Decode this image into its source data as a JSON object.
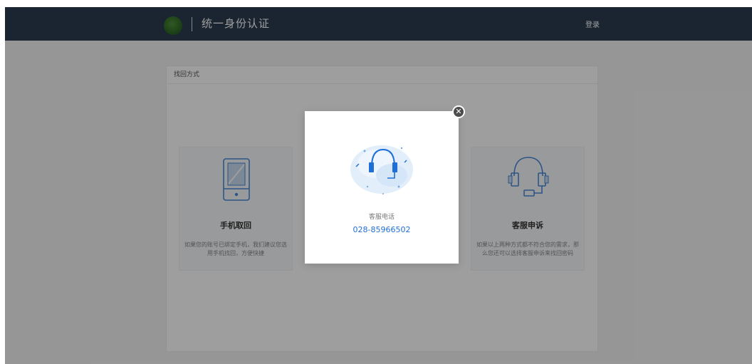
{
  "header": {
    "app_title": "统一身份认证",
    "login_label": "登录"
  },
  "panel": {
    "title": "找回方式"
  },
  "options": [
    {
      "title": "手机取回",
      "description": "如果您的账号已绑定手机，我们建议您选用手机找回，方便快捷",
      "icon": "phone-icon"
    },
    {
      "title": "客服申诉",
      "description": "如果以上两种方式都不符合您的需求，那么您还可以选择客服申诉来找回密码",
      "icon": "headset-icon"
    }
  ],
  "modal": {
    "label": "客服电话",
    "phone": "028-85966502",
    "icon": "customer-service-headset-icon",
    "close_icon": "close-icon"
  },
  "colors": {
    "topbar": "#2b3d4f",
    "accent": "#1e6fd6",
    "icon_stroke": "#4a8ad8",
    "overlay": "rgba(0,0,0,0.38)"
  }
}
